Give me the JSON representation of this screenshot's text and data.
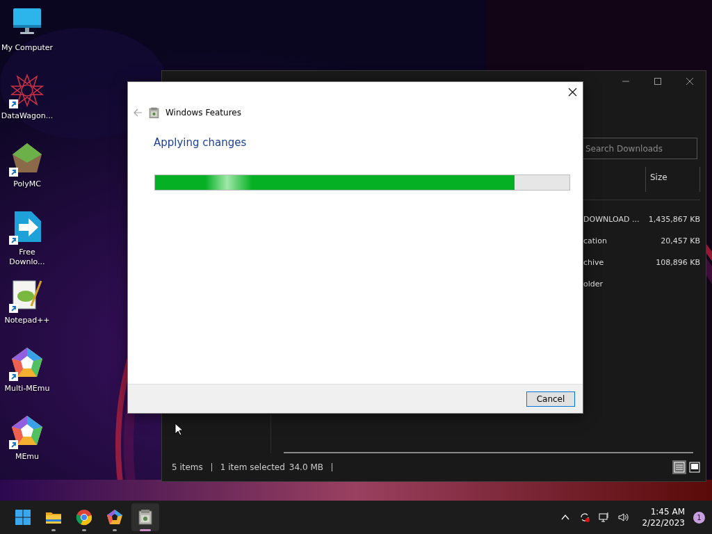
{
  "desktop_icons": [
    {
      "label": "My Computer",
      "kind": "computer",
      "shortcut": false
    },
    {
      "label": "DataWagon...",
      "kind": "star",
      "shortcut": true
    },
    {
      "label": "PolyMC",
      "kind": "block",
      "shortcut": true
    },
    {
      "label": "Free Downlo...",
      "kind": "download",
      "shortcut": true
    },
    {
      "label": "Notepad++",
      "kind": "notepad",
      "shortcut": true
    },
    {
      "label": "Multi-MEmu",
      "kind": "pentagon",
      "shortcut": true
    },
    {
      "label": "MEmu",
      "kind": "pentagon",
      "shortcut": true
    }
  ],
  "explorer": {
    "search": {
      "placeholder": "Search Downloads"
    },
    "columns": [
      "Size"
    ],
    "rows": [
      {
        "name": "DOWNLOAD ...",
        "size": "1,435,867 KB"
      },
      {
        "name": "cation",
        "size": "20,457 KB"
      },
      {
        "name": "chive",
        "size": "108,896 KB"
      },
      {
        "name": "older"
      }
    ],
    "status": {
      "items": "5 items",
      "selection": "1 item selected",
      "selection_size": "34.0 MB"
    },
    "views": [
      {
        "kind": "details",
        "selected": true
      },
      {
        "kind": "preview",
        "selected": false
      }
    ]
  },
  "dialog": {
    "title": "Windows Features",
    "heading": "Applying changes",
    "back_disabled": true,
    "progress": {
      "level": 0.868
    },
    "buttons": [
      "Cancel"
    ]
  },
  "taskbar": {
    "apps": [
      {
        "kind": "start",
        "running": false,
        "selected": false
      },
      {
        "kind": "folder",
        "running": true,
        "selected": false
      },
      {
        "kind": "browser",
        "running": true,
        "selected": false
      },
      {
        "kind": "pentagon",
        "running": true,
        "selected": false
      },
      {
        "kind": "features",
        "running": true,
        "selected": true
      }
    ],
    "time": "1:45 AM",
    "date": "2/22/2023",
    "notifications": "1"
  }
}
